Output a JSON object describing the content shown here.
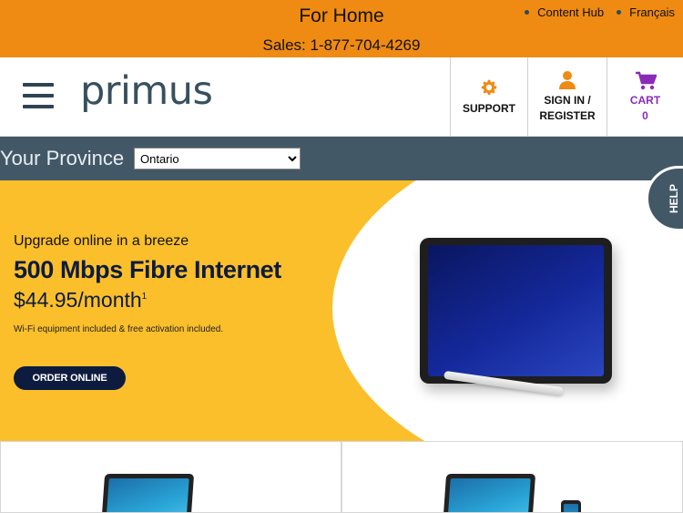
{
  "topbar": {
    "title": "For Home",
    "sales": "Sales: 1-877-704-4269",
    "links": [
      {
        "label": "Content Hub"
      },
      {
        "label": "Français"
      }
    ]
  },
  "header": {
    "logo": "primus",
    "support_label": "SUPPORT",
    "signin_label_1": "SIGN IN /",
    "signin_label_2": "REGISTER",
    "cart_label": "CART",
    "cart_count": "0"
  },
  "province": {
    "label": "Your Province",
    "selected": "Ontario"
  },
  "hero": {
    "eyebrow": "Upgrade online in a breeze",
    "headline": "500 Mbps Fibre Internet",
    "price": "$44.95/month",
    "price_footnote": "1",
    "fine_print": "Wi-Fi equipment included & free activation included.",
    "cta": "ORDER ONLINE"
  },
  "help": {
    "label": "HELP"
  },
  "colors": {
    "topbar": "#ef8a12",
    "nav": "#435866",
    "hero_bg": "#fbbf2b",
    "brand_navy": "#0d1b3e",
    "cart_purple": "#8a2bb8"
  }
}
